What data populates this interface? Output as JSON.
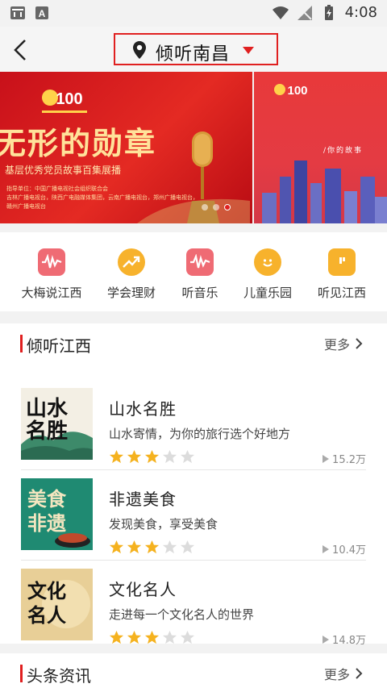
{
  "status_bar": {
    "time": "4:08"
  },
  "header": {
    "title": "倾听南昌"
  },
  "banner": {
    "headline": "无形的勋章",
    "subtitle": "基层优秀党员故事百集展播",
    "org_line": "指导单位：中国广播电视社会组织联合会",
    "org_line2": "吉林广播电视台，陕西广电融媒体集团，云南广播电视台，郑州广播电视台，赣州广播电视台",
    "next_text": "/你的故事"
  },
  "quick_nav": [
    {
      "label": "大梅说江西",
      "icon": "wave-icon",
      "color": "#ef6b74"
    },
    {
      "label": "学会理财",
      "icon": "trend-icon",
      "color": "#f7b22c"
    },
    {
      "label": "听音乐",
      "icon": "wave-icon",
      "color": "#ef6b74"
    },
    {
      "label": "儿童乐园",
      "icon": "smile-icon",
      "color": "#f7b22c"
    },
    {
      "label": "听见江西",
      "icon": "chat-icon",
      "color": "#f7b22c"
    }
  ],
  "section1": {
    "title": "倾听江西",
    "more": "更多",
    "items": [
      {
        "title": "山水名胜",
        "desc": "山水寄情，为你的旅行选个好地方",
        "rating": 3,
        "plays": "15.2万",
        "thumb_text": "山水名胜"
      },
      {
        "title": "非遗美食",
        "desc": "发现美食，享受美食",
        "rating": 3,
        "plays": "10.4万",
        "thumb_text": "美食非遗"
      },
      {
        "title": "文化名人",
        "desc": "走进每一个文化名人的世界",
        "rating": 3,
        "plays": "14.8万",
        "thumb_text": "文化名人"
      }
    ]
  },
  "section2": {
    "title": "头条资讯",
    "more": "更多"
  }
}
